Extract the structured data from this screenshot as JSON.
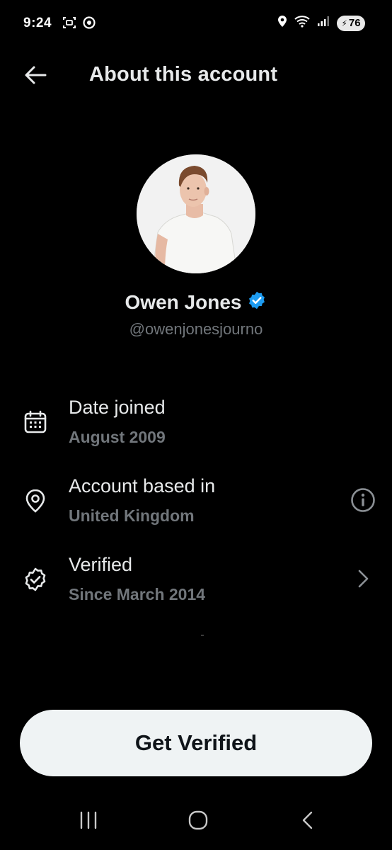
{
  "status_bar": {
    "time": "9:24",
    "left_icons": [
      "screenshot-icon",
      "sync-icon"
    ],
    "right_icons": [
      "location-icon",
      "wifi-icon",
      "signal-icon"
    ],
    "battery_level": "76",
    "charging": true
  },
  "header": {
    "title": "About this account",
    "back_icon": "arrow-left-icon"
  },
  "profile": {
    "name": "Owen Jones",
    "handle": "@owenjonesjourno",
    "verified": true,
    "verified_color": "#1d9bf0"
  },
  "info_rows": [
    {
      "icon": "calendar-icon",
      "title": "Date joined",
      "value": "August 2009",
      "action": null
    },
    {
      "icon": "location-pin-icon",
      "title": "Account based in",
      "value": "United Kingdom",
      "action": "info-icon"
    },
    {
      "icon": "verified-badge-icon",
      "title": "Verified",
      "value": "Since March 2014",
      "action": "chevron-right-icon"
    }
  ],
  "cta": {
    "label": "Get Verified"
  },
  "nav_bar": {
    "items": [
      "recent-apps-icon",
      "home-icon",
      "back-icon"
    ]
  },
  "colors": {
    "background": "#000000",
    "primary_text": "#e7e9ea",
    "secondary_text": "#71767b",
    "button_bg": "#eff3f4",
    "button_text": "#0f1419"
  }
}
